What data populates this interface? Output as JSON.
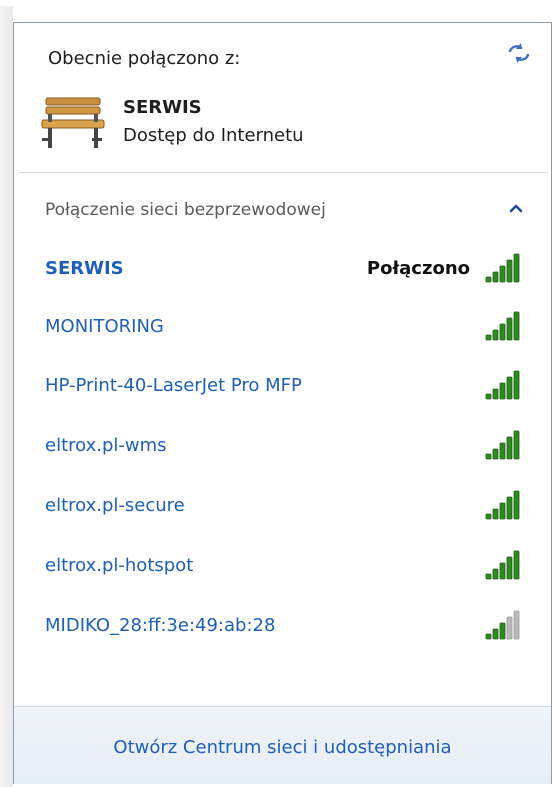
{
  "header": {
    "label": "Obecnie połączono z:",
    "refresh_icon": "refresh-arrows-icon"
  },
  "current_connection": {
    "icon": "bench-icon",
    "name": "SERWIS",
    "status": "Dostęp do Internetu"
  },
  "section": {
    "label": "Połączenie sieci bezprzewodowej",
    "toggle_icon": "chevron-up-icon"
  },
  "networks": [
    {
      "name": "SERWIS",
      "state": "Połączono",
      "connected": true,
      "signal_bars": 5,
      "signal_color": "#2e8b20"
    },
    {
      "name": "MONITORING",
      "state": "",
      "connected": false,
      "signal_bars": 5,
      "signal_color": "#2e8b20"
    },
    {
      "name": "HP-Print-40-LaserJet Pro MFP",
      "state": "",
      "connected": false,
      "signal_bars": 5,
      "signal_color": "#2e8b20"
    },
    {
      "name": "eltrox.pl-wms",
      "state": "",
      "connected": false,
      "signal_bars": 5,
      "signal_color": "#2e8b20"
    },
    {
      "name": "eltrox.pl-secure",
      "state": "",
      "connected": false,
      "signal_bars": 5,
      "signal_color": "#2e8b20"
    },
    {
      "name": "eltrox.pl-hotspot",
      "state": "",
      "connected": false,
      "signal_bars": 5,
      "signal_color": "#2e8b20"
    },
    {
      "name": "MIDIKO_28:ff:3e:49:ab:28",
      "state": "",
      "connected": false,
      "signal_bars": 3,
      "signal_color": "#2e8b20"
    }
  ],
  "footer": {
    "link": "Otwórz Centrum sieci i udostępniania"
  },
  "colors": {
    "link": "#1f5fb5",
    "signal_active": "#2e8b20",
    "signal_inactive": "#b9b9b9"
  }
}
